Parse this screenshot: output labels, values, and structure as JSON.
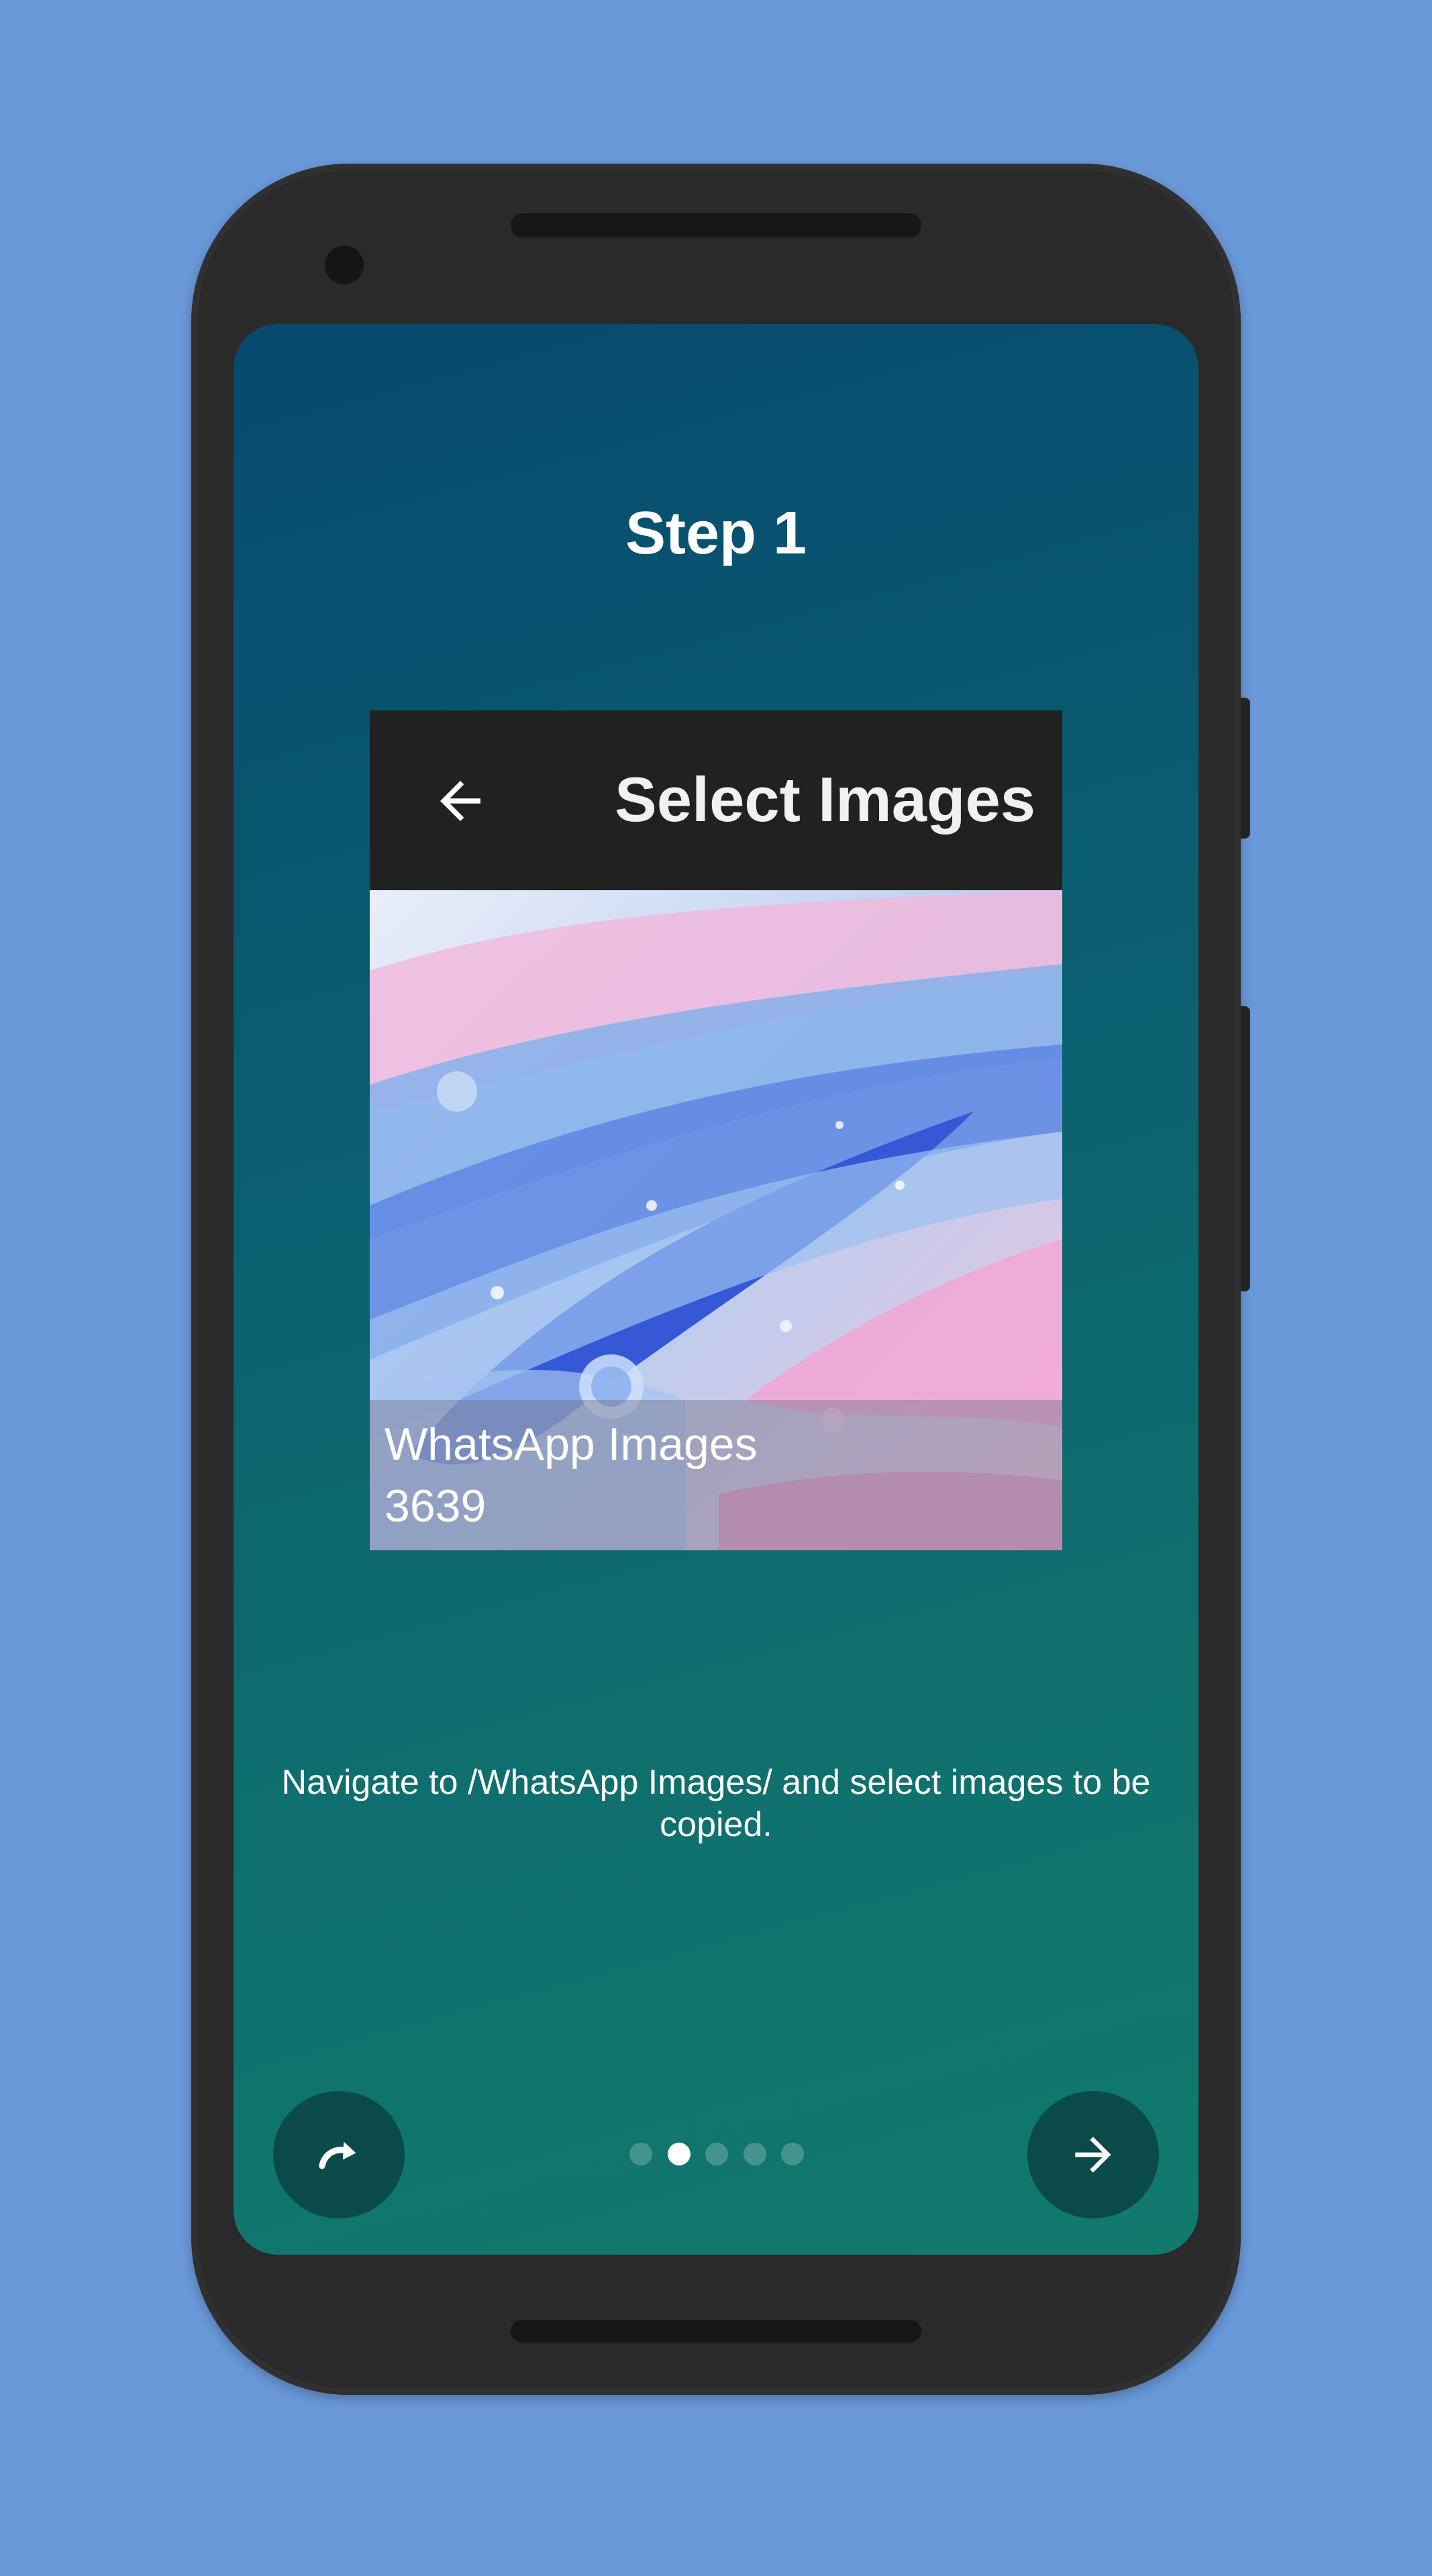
{
  "onboarding": {
    "step_title": "Step 1",
    "preview": {
      "toolbar_title": "Select Images",
      "back_icon": "arrow-back-icon",
      "folder_name": "WhatsApp Images",
      "folder_count": "3639"
    },
    "description": "Navigate to /WhatsApp Images/ and select images to be copied.",
    "pager": {
      "total": 5,
      "active_index": 1
    },
    "skip_icon": "redo-arrow-icon",
    "next_icon": "arrow-forward-icon"
  },
  "colors": {
    "background": "#6a99da",
    "screen_top": "#064a6f",
    "screen_bottom": "#117a6d",
    "button": "#0a4b4a",
    "toolbar": "#212121"
  }
}
